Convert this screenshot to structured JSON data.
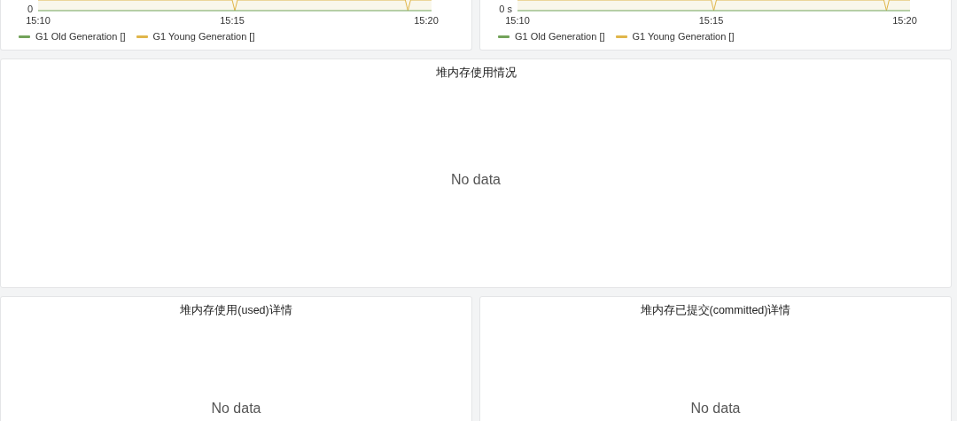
{
  "top_panels": [
    {
      "y_tick": "0",
      "x_ticks": [
        "15:10",
        "15:15",
        "15:20"
      ],
      "legend": [
        {
          "label": "G1 Old Generation []",
          "color": "#73a35a"
        },
        {
          "label": "G1 Young Generation []",
          "color": "#e0b64a"
        }
      ]
    },
    {
      "y_tick": "0 s",
      "x_ticks": [
        "15:10",
        "15:15",
        "15:20"
      ],
      "legend": [
        {
          "label": "G1 Old Generation []",
          "color": "#73a35a"
        },
        {
          "label": "G1 Young Generation []",
          "color": "#e0b64a"
        }
      ]
    }
  ],
  "heap_panel": {
    "title": "堆内存使用情况",
    "message": "No data"
  },
  "bottom_panels": [
    {
      "title": "堆内存使用(used)详情",
      "message": "No data"
    },
    {
      "title": "堆内存已提交(committed)详情",
      "message": "No data"
    }
  ]
}
